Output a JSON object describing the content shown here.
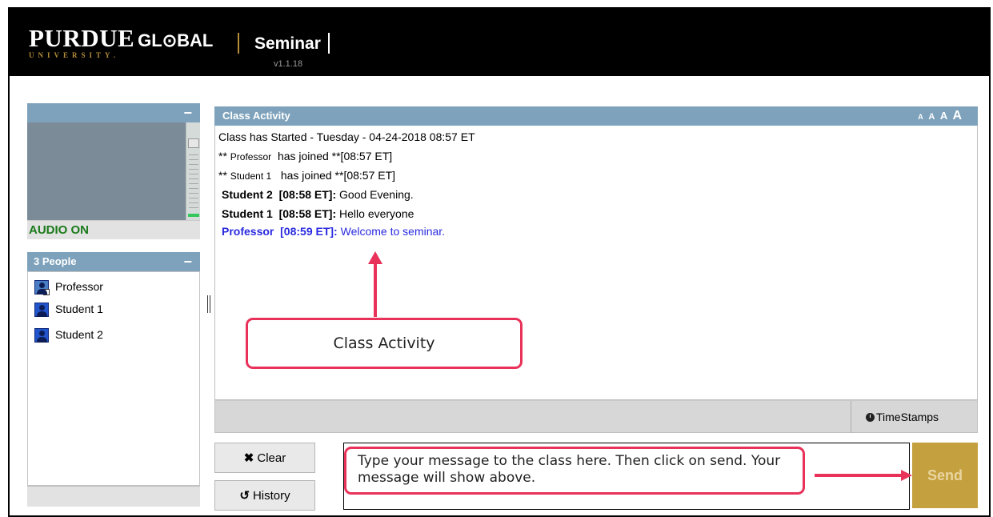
{
  "header": {
    "logo_main": "PURDUE",
    "logo_global": "GL⊙BAL",
    "logo_sub": "UNIVERSITY.",
    "app_title": "Seminar",
    "version": "v1.1.18"
  },
  "audio": {
    "status": "AUDIO ON",
    "collapse_glyph": "−"
  },
  "people": {
    "header": "3 People",
    "collapse_glyph": "−",
    "list": [
      {
        "name": "Professor",
        "role": "professor",
        "icon": "professor-avatar-icon"
      },
      {
        "name": "Student 1",
        "role": "student",
        "icon": "student-avatar-icon"
      },
      {
        "name": "Student 2",
        "role": "student",
        "icon": "student-avatar-icon"
      }
    ]
  },
  "class_activity": {
    "title": "Class Activity",
    "font_sizes": [
      "A",
      "A",
      "A",
      "A"
    ],
    "started_line": "Class has Started  - Tuesday - 04-24-2018  08:57 ET",
    "joins": [
      {
        "prefix": "**",
        "name": "Professor",
        "text": "has joined **[08:57 ET]"
      },
      {
        "prefix": "**",
        "name": "Student 1",
        "text": "has joined **[08:57 ET]"
      }
    ],
    "messages": [
      {
        "sender": "Student 2",
        "time": "[08:58 ET]:",
        "text": "Good Evening."
      },
      {
        "sender": "Student 1",
        "time": "[08:58 ET]:",
        "text": "Hello everyone"
      },
      {
        "sender": "Professor",
        "time": "[08:59 ET]:",
        "text": "Welcome to seminar."
      }
    ],
    "timestamps_label": "TimeStamps"
  },
  "controls": {
    "clear_label": "Clear",
    "history_label": "History",
    "send_label": "Send"
  },
  "annotations": {
    "activity_callout": "Class Activity",
    "message_callout": "Type your message to the class here. Then click on send. Your message will show above."
  },
  "colors": {
    "header_bg": "#000000",
    "panel_header": "#7ea2bb",
    "audio_on": "#1a7a1a",
    "professor_message": "#2a2ae0",
    "send_button": "#c4a03e",
    "callout_border": "#e8325a",
    "brand_gold": "#b58e3a"
  }
}
